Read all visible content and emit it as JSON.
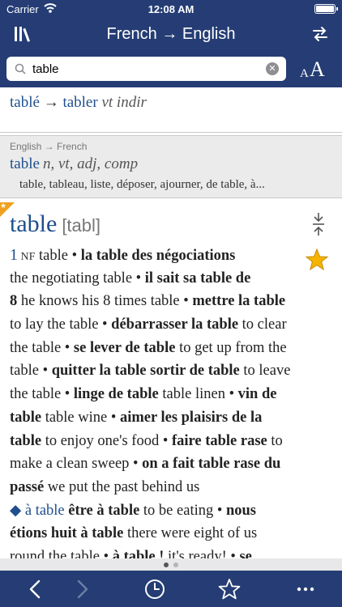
{
  "status": {
    "carrier": "Carrier",
    "time": "12:08 AM"
  },
  "nav": {
    "title": "French → English"
  },
  "search": {
    "value": "table",
    "font_small": "A",
    "font_big": "A"
  },
  "results": [
    {
      "word": "tablé",
      "arrow": " → ",
      "lemma": "tabler",
      "gram": " vt indir"
    },
    {
      "direction": "English → French",
      "word": "table",
      "pos": "n, vt, adj, comp",
      "translations": "table, tableau, liste, déposer, ajourner, de table, à..."
    }
  ],
  "entry": {
    "headword": "table",
    "phonetic": "[tabl]",
    "lines": [
      [
        {
          "t": "1",
          "s": "sense"
        },
        {
          "t": " NF",
          "s": "nf"
        },
        {
          "t": " table • "
        },
        {
          "t": "la table des négociations",
          "s": "b"
        }
      ],
      [
        {
          "t": "the negotiating table • "
        },
        {
          "t": "il sait sa table de",
          "s": "b"
        }
      ],
      [
        {
          "t": "8",
          "s": "b"
        },
        {
          "t": " he knows his 8 times table • "
        },
        {
          "t": "mettre la table",
          "s": "b"
        }
      ],
      [
        {
          "t": "to lay the table • "
        },
        {
          "t": "débarrasser la table",
          "s": "b"
        },
        {
          "t": " to clear"
        }
      ],
      [
        {
          "t": "the table • "
        },
        {
          "t": "se lever de table",
          "s": "b"
        },
        {
          "t": " to get up from the"
        }
      ],
      [
        {
          "t": "table • "
        },
        {
          "t": "quitter la table sortir de table",
          "s": "b"
        },
        {
          "t": " to leave"
        }
      ],
      [
        {
          "t": "the table • "
        },
        {
          "t": "linge de table",
          "s": "b"
        },
        {
          "t": " table linen • "
        },
        {
          "t": "vin de",
          "s": "b"
        }
      ],
      [
        {
          "t": "table",
          "s": "b"
        },
        {
          "t": " table wine • "
        },
        {
          "t": "aimer les plaisirs de la",
          "s": "b"
        }
      ],
      [
        {
          "t": "table",
          "s": "b"
        },
        {
          "t": " to enjoy one's food • "
        },
        {
          "t": "faire table rase",
          "s": "b"
        },
        {
          "t": " to"
        }
      ],
      [
        {
          "t": "make a clean sweep • "
        },
        {
          "t": "on a fait table rase du",
          "s": "b"
        }
      ],
      [
        {
          "t": "passé",
          "s": "b"
        },
        {
          "t": " we put the past behind us"
        }
      ],
      [
        {
          "t": "◆ ",
          "s": "dia"
        },
        {
          "t": "à table",
          "s": "dia"
        },
        {
          "t": " "
        },
        {
          "t": "être à table",
          "s": "b"
        },
        {
          "t": " to be eating • "
        },
        {
          "t": "nous",
          "s": "b"
        }
      ],
      [
        {
          "t": "étions huit à table",
          "s": "b"
        },
        {
          "t": " there were eight of us"
        }
      ],
      [
        {
          "t": "round the table • "
        },
        {
          "t": "à table !",
          "s": "b"
        },
        {
          "t": " it's ready! • "
        },
        {
          "t": "se",
          "s": "b"
        }
      ]
    ]
  },
  "pager": {
    "pages": 2,
    "current": 0
  },
  "colors": {
    "bar": "#253d74",
    "link": "#1f4f8d",
    "star": "#f4b400",
    "corner": "#f0a020"
  },
  "toolbar": {
    "icons": [
      "back-icon",
      "forward-icon",
      "history-icon",
      "favorites-icon",
      "more-icon"
    ]
  }
}
